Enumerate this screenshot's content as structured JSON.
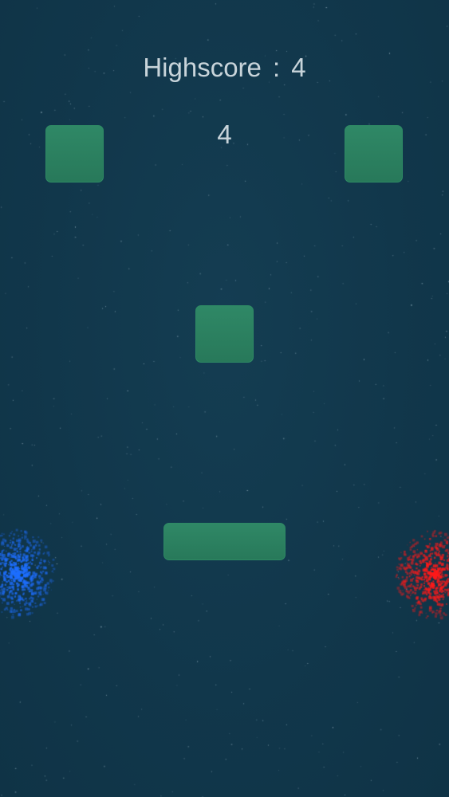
{
  "hud": {
    "highscore_label": "Highscore",
    "highscore_separator": ":",
    "highscore_value": "4",
    "score_value": "4"
  },
  "colors": {
    "background": "#11374b",
    "block": "#2b7f5e",
    "text": "#c8d4da",
    "blue_player": "#1e6fff",
    "red_player": "#ff1a1a"
  },
  "sprites": {
    "blocks": [
      "block",
      "block",
      "block"
    ],
    "paddle": "paddle",
    "left_emitter": "blue-particle-cloud",
    "right_emitter": "red-particle-cloud"
  }
}
